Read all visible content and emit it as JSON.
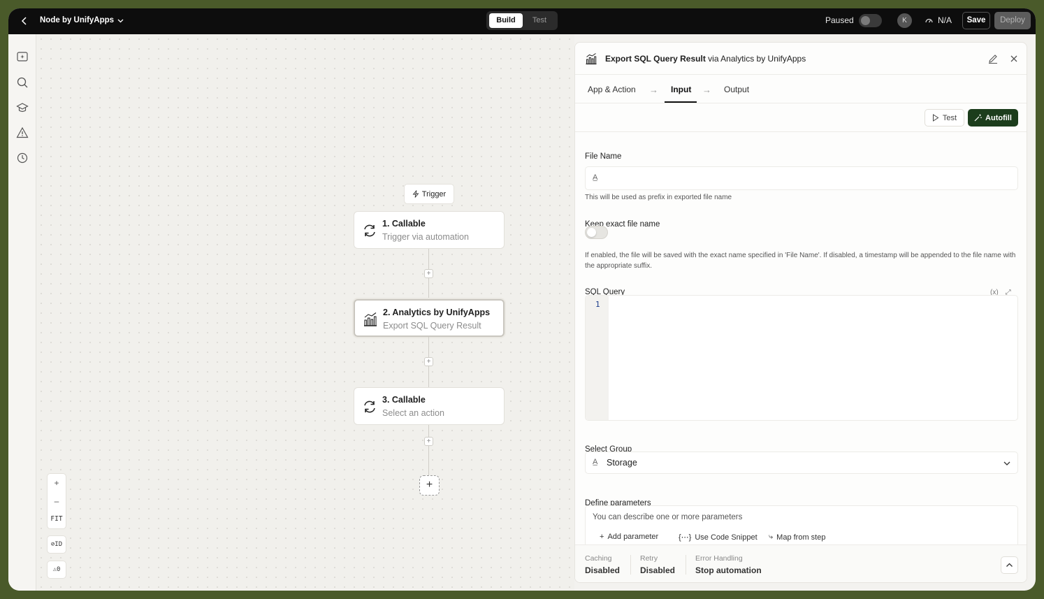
{
  "topbar": {
    "app_title": "Node by UnifyApps",
    "build_tab": "Build",
    "test_tab": "Test",
    "status_label": "Paused",
    "avatar_initial": "K",
    "metric": "N/A",
    "save_label": "Save",
    "deploy_label": "Deploy"
  },
  "canvas": {
    "trigger_label": "Trigger",
    "nodes": [
      {
        "title": "1. Callable",
        "subtitle": "Trigger via automation"
      },
      {
        "title": "2. Analytics by UnifyApps",
        "subtitle": "Export SQL Query Result"
      },
      {
        "title": "3. Callable",
        "subtitle": "Select an action"
      }
    ],
    "zoom_in": "+",
    "zoom_out": "–",
    "fit_label": "FIT",
    "id_toggle": "ID",
    "warnings_count": "0",
    "add_step": "+"
  },
  "panel": {
    "title_bold": "Export SQL Query Result",
    "title_via": " via ",
    "title_app": "Analytics by UnifyApps",
    "tabs": [
      "App & Action",
      "Input",
      "Output"
    ],
    "active_tab": "Input",
    "test_label": "Test",
    "autofill_label": "Autofill",
    "file_name_label": "File Name",
    "file_name_value": "",
    "file_name_help": "This will be used as prefix in exported file name",
    "keep_exact_label": "Keep exact file name",
    "keep_exact_help": "If enabled, the file will be saved with the exact name specified in 'File Name'. If disabled, a timestamp will be appended to the file name with the appropriate suffix.",
    "sql_label": "SQL Query",
    "sql_line": "1",
    "group_label": "Select Group",
    "group_value": "Storage",
    "params_label": "Define parameters",
    "params_placeholder": "You can describe one or more parameters",
    "add_parameter": "Add parameter",
    "use_code_snippet": "Use Code Snippet",
    "map_from_step": "Map from step",
    "footer": {
      "caching_label": "Caching",
      "caching_value": "Disabled",
      "retry_label": "Retry",
      "retry_value": "Disabled",
      "error_label": "Error Handling",
      "error_value": "Stop automation"
    }
  },
  "colors": {
    "frame": "#4a5a2a",
    "topbar": "#0d0d0d",
    "autofill": "#1c3d1c"
  }
}
